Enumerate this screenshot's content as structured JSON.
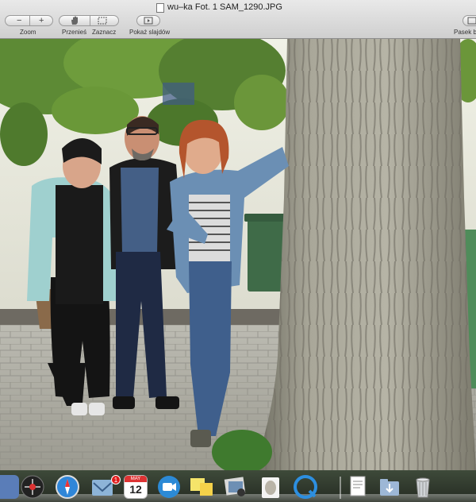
{
  "window": {
    "title": "wu–ka Fot. 1 SAM_1290.JPG"
  },
  "toolbar": {
    "zoom_label": "Zoom",
    "zoom_out_glyph": "−",
    "zoom_in_glyph": "+",
    "move_label": "Przenieś",
    "select_label": "Zaznacz",
    "slideshow_label": "Pokaż slajdów",
    "sidebar_label": "Pasek b"
  },
  "dock": {
    "calendar_month": "MAY",
    "calendar_day": "12",
    "mail_badge": "1"
  },
  "colors": {
    "wall": "#e9eadf",
    "tree_bark": "#9d9b8c",
    "foliage": "#5d8a35",
    "pavement": "#a7a69e",
    "dock_bg": "#2f372b"
  }
}
